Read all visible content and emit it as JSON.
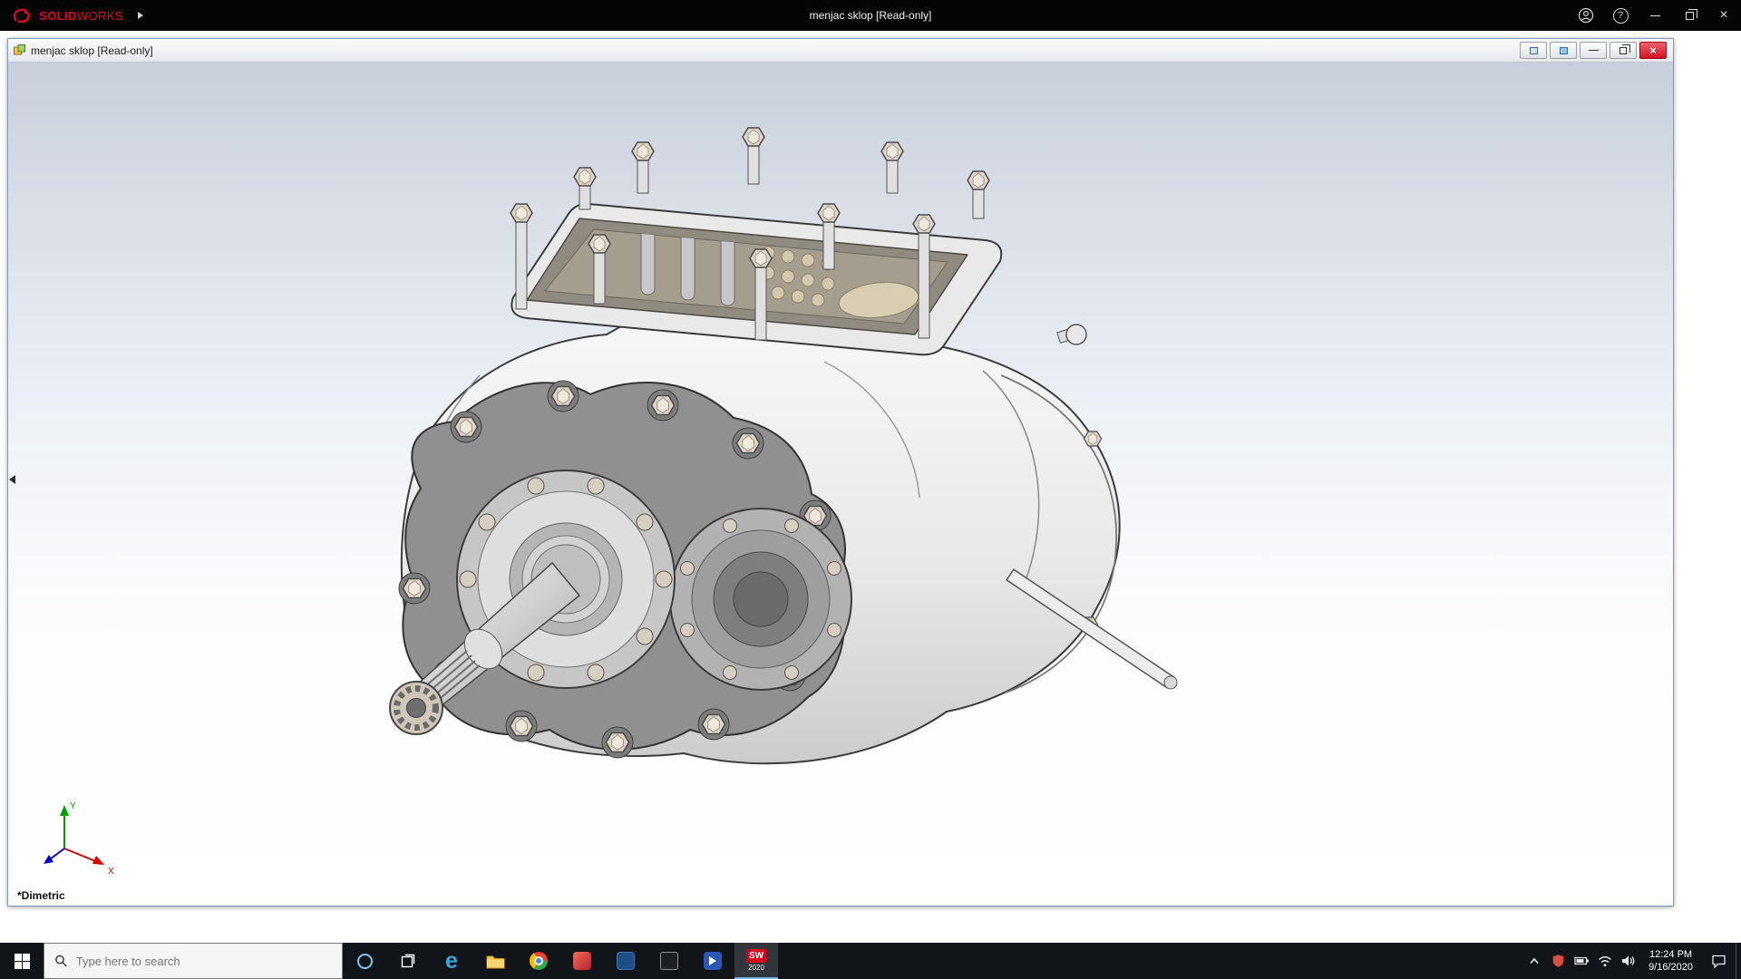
{
  "app": {
    "title": "menjac sklop [Read-only]",
    "brand_bold": "SOLID",
    "brand_light": "WORKS"
  },
  "doc": {
    "title": "menjac sklop [Read-only]"
  },
  "viewport": {
    "view_orientation": "*Dimetric",
    "triad": {
      "x_label": "X",
      "y_label": "Y"
    }
  },
  "taskbar": {
    "search_placeholder": "Type here to search",
    "solidworks_year": "2020",
    "clock_time": "12:24 PM",
    "clock_date": "9/16/2020",
    "pinned_icons": [
      "start",
      "search",
      "cortana",
      "task-view",
      "edge",
      "file-explorer",
      "chrome",
      "pinned-app-1",
      "pinned-app-2",
      "pinned-app-3",
      "pinned-app-4",
      "solidworks-2020"
    ],
    "tray_icons": [
      "hidden-icons-chevron",
      "shield",
      "battery",
      "network",
      "volume",
      "clock",
      "action-center",
      "show-desktop"
    ]
  },
  "glyphs": {
    "close": "×",
    "help": "?",
    "edge": "e",
    "solidworks_mark": "SW"
  },
  "colors": {
    "brand_red": "#e4002b",
    "doc_close_red": "#d41324",
    "taskbar_bg": "#11151a",
    "viewport_top": "#c8cfdb",
    "triad_x": "#d40000",
    "triad_y": "#00a000",
    "triad_z": "#0000cc"
  }
}
